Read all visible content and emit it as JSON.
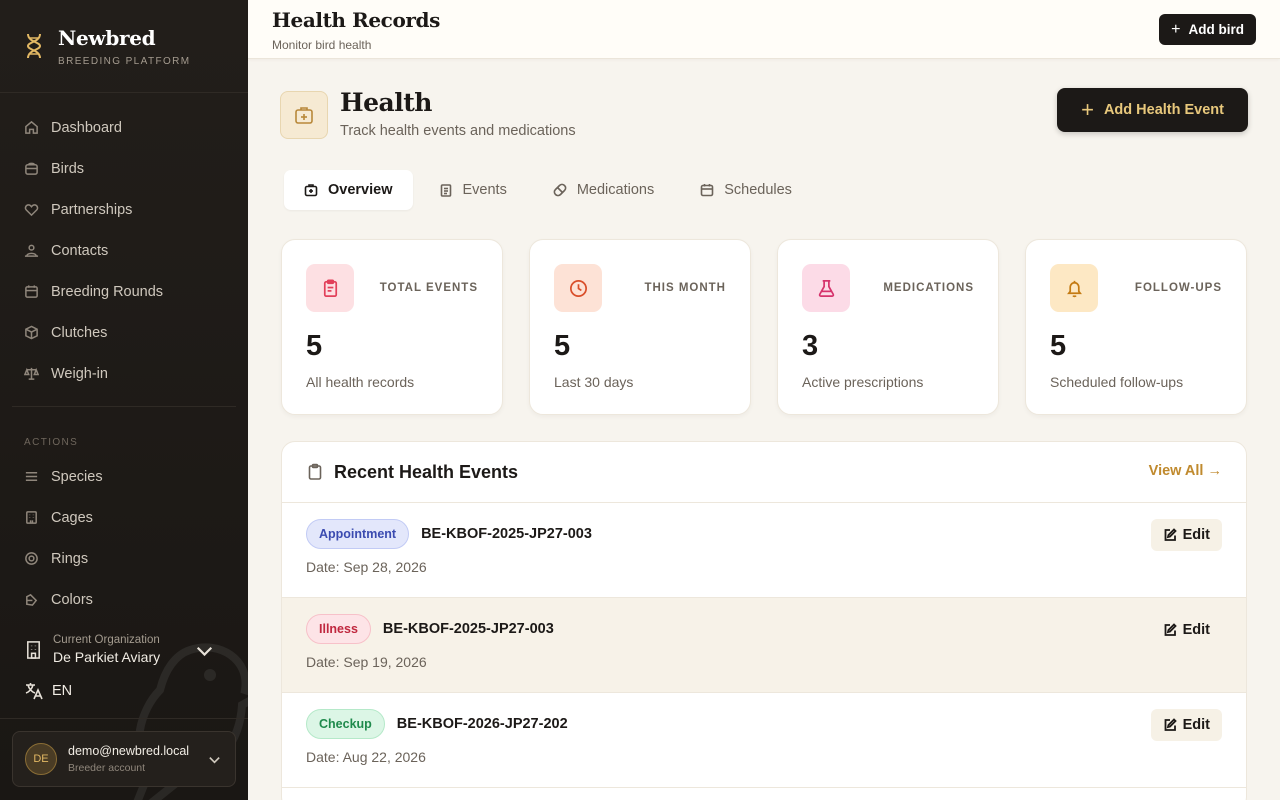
{
  "brand": {
    "name": "Newbred",
    "subtitle": "BREEDING PLATFORM"
  },
  "sidebar": {
    "items": [
      {
        "label": "Dashboard",
        "icon": "home-icon"
      },
      {
        "label": "Birds",
        "icon": "nest-icon"
      },
      {
        "label": "Partnerships",
        "icon": "heart-icon"
      },
      {
        "label": "Contacts",
        "icon": "users-icon"
      },
      {
        "label": "Breeding Rounds",
        "icon": "calendar-icon"
      },
      {
        "label": "Clutches",
        "icon": "box-icon"
      },
      {
        "label": "Weigh-in",
        "icon": "scale-icon"
      }
    ],
    "section_label": "ACTIONS",
    "actions": [
      {
        "label": "Species",
        "icon": "list-icon"
      },
      {
        "label": "Cages",
        "icon": "cage-icon"
      },
      {
        "label": "Rings",
        "icon": "ring-icon"
      },
      {
        "label": "Colors",
        "icon": "palette-icon"
      }
    ],
    "org": {
      "label": "Current Organization",
      "name": "De Parkiet Aviary"
    },
    "language": "EN",
    "account": {
      "initials": "DE",
      "email": "demo@newbred.local",
      "role": "Breeder account"
    }
  },
  "topbar": {
    "title": "Health Records",
    "subtitle": "Monitor bird health",
    "button": "Add bird"
  },
  "page": {
    "title": "Health",
    "subtitle": "Track health events and medications",
    "button": "Add Health Event"
  },
  "tabs": [
    {
      "label": "Overview",
      "icon": "medkit-icon",
      "active": true
    },
    {
      "label": "Events",
      "icon": "clipboard-icon",
      "active": false
    },
    {
      "label": "Medications",
      "icon": "pill-icon",
      "active": false
    },
    {
      "label": "Schedules",
      "icon": "calendar-icon",
      "active": false
    }
  ],
  "stats": [
    {
      "label": "TOTAL EVENTS",
      "value": "5",
      "desc": "All health records",
      "icon": "clipboard-icon",
      "color": "#e2405a",
      "bg": "#fde0e3"
    },
    {
      "label": "THIS MONTH",
      "value": "5",
      "desc": "Last 30 days",
      "icon": "clock-icon",
      "color": "#d94e2a",
      "bg": "#fde2d6"
    },
    {
      "label": "MEDICATIONS",
      "value": "3",
      "desc": "Active prescriptions",
      "icon": "flask-icon",
      "color": "#d6336c",
      "bg": "#fcdbe7"
    },
    {
      "label": "FOLLOW-UPS",
      "value": "5",
      "desc": "Scheduled follow-ups",
      "icon": "bell-icon",
      "color": "#c47a12",
      "bg": "#fde8c4"
    }
  ],
  "recent": {
    "title": "Recent Health Events",
    "view_all": "View All →",
    "edit_label": "Edit",
    "events": [
      {
        "type": "Appointment",
        "bird": "BE-KBOF-2025-JP27-003",
        "date": "Date: Sep 28, 2026",
        "badge_color": "#3b4bb0",
        "badge_bg": "#e3e7fb",
        "badge_border": "#c2cbf5"
      },
      {
        "type": "Illness",
        "bird": "BE-KBOF-2025-JP27-003",
        "date": "Date: Sep 19, 2026",
        "badge_color": "#c0283f",
        "badge_bg": "#fde4e7",
        "badge_border": "#f7c1c9"
      },
      {
        "type": "Checkup",
        "bird": "BE-KBOF-2026-JP27-202",
        "date": "Date: Aug 22, 2026",
        "badge_color": "#1f8a4c",
        "badge_bg": "#dcf6e6",
        "badge_border": "#b5e9c9"
      }
    ]
  }
}
